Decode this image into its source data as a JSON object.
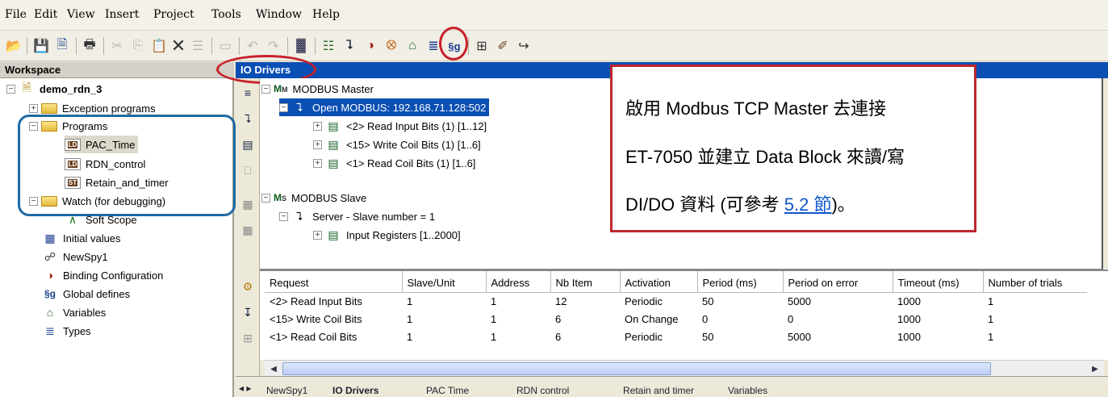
{
  "menu": [
    "File",
    "Edit",
    "View",
    "Insert",
    "Project",
    "Tools",
    "Window",
    "Help"
  ],
  "toolbar_icons": [
    "open-icon",
    "save-icon",
    "save-all-icon",
    "print-icon",
    "cut-icon",
    "copy-icon",
    "paste-icon",
    "delete-icon",
    "properties-icon",
    "undo-icon",
    "redo-icon",
    "build-icon",
    "io-board-icon",
    "network-icon",
    "binding-icon",
    "spy-icon",
    "home-icon",
    "types-icon",
    "global-defines-icon",
    "layout-icon",
    "library-icon",
    "exit-icon"
  ],
  "workspace": {
    "title": "Workspace",
    "project": "demo_rdn_3",
    "items": {
      "exception": "Exception programs",
      "programs": "Programs",
      "pac_time": "PAC_Time",
      "rdn_control": "RDN_control",
      "retain": "Retain_and_timer",
      "watch": "Watch (for debugging)",
      "soft_scope": "Soft Scope",
      "initial": "Initial values",
      "newspy": "NewSpy1",
      "binding": "Binding Configuration",
      "global": "Global defines",
      "variables": "Variables",
      "types": "Types"
    },
    "badges": {
      "st": "ST"
    }
  },
  "io": {
    "title": "IO Drivers",
    "master": "MODBUS Master",
    "open": "Open MODBUS: 192.168.71.128:502",
    "b1": "<2> Read Input Bits (1) [1..12]",
    "b2": "<15> Write Coil Bits (1) [1..6]",
    "b3": "<1> Read Coil Bits (1) [1..6]",
    "slave": "MODBUS Slave",
    "server": "Server - Slave number = 1",
    "regs": "Input Registers [1..2000]"
  },
  "grid": {
    "headers": [
      "Request",
      "Slave/Unit",
      "Address",
      "Nb Item",
      "Activation",
      "Period (ms)",
      "Period on error",
      "Timeout (ms)",
      "Number of trials"
    ],
    "rows": [
      [
        "<2> Read Input Bits",
        "1",
        "1",
        "12",
        "Periodic",
        "50",
        "5000",
        "1000",
        "1"
      ],
      [
        "<15> Write Coil Bits",
        "1",
        "1",
        "6",
        "On Change",
        "0",
        "0",
        "1000",
        "1"
      ],
      [
        "<1> Read Coil Bits",
        "1",
        "1",
        "6",
        "Periodic",
        "50",
        "5000",
        "1000",
        "1"
      ]
    ]
  },
  "tabs": [
    "NewSpy1",
    "IO Drivers",
    "PAC Time",
    "RDN control",
    "Retain and timer",
    "Variables"
  ],
  "callout": {
    "line1": "啟用 Modbus TCP Master 去連接",
    "line2": "ET-7050 並建立 Data Block 來讀/寫",
    "line3_pre": "DI/DO 資料 (可參考 ",
    "line3_link": "5.2 節",
    "line3_post": ")。"
  },
  "colors": {
    "accent": "#0a4fb4",
    "highlight": "#c8202a",
    "group": "#1f6aa5"
  }
}
